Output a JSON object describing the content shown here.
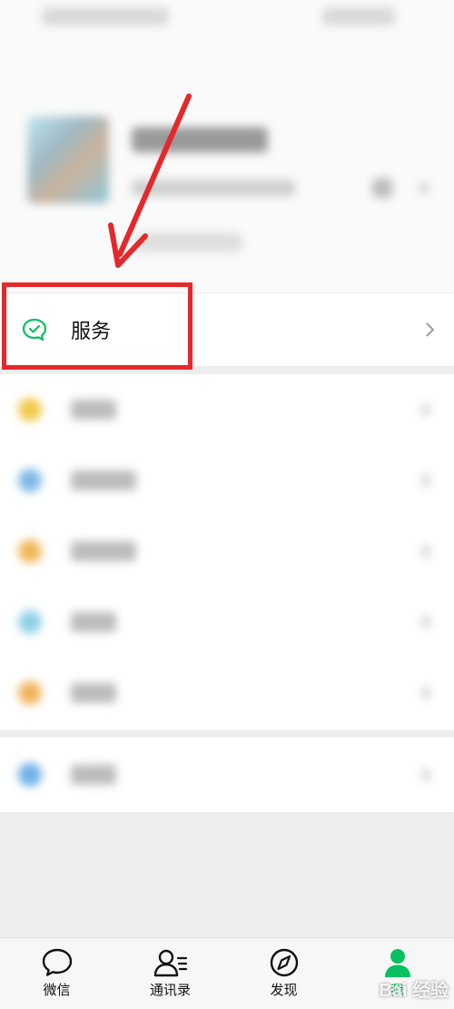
{
  "service_row": {
    "label": "服务"
  },
  "tabs": [
    {
      "label": "微信",
      "icon": "chat-bubble-icon",
      "active": false
    },
    {
      "label": "通讯录",
      "icon": "contacts-icon",
      "active": false
    },
    {
      "label": "发现",
      "icon": "compass-icon",
      "active": false
    },
    {
      "label": "我",
      "icon": "profile-icon",
      "active": true
    }
  ],
  "blurred_rows": [
    {
      "icon_color": "#f2c94c"
    },
    {
      "icon_color": "#7fb8e6"
    },
    {
      "icon_color": "#f0b75a"
    },
    {
      "icon_color": "#8fd0e8"
    },
    {
      "icon_color": "#f2b35c"
    }
  ],
  "settings_row": {
    "icon_color": "#6fb0e6"
  },
  "colors": {
    "accent": "#07c160",
    "annotation": "#e4282b"
  },
  "watermark": "Bai 经验"
}
